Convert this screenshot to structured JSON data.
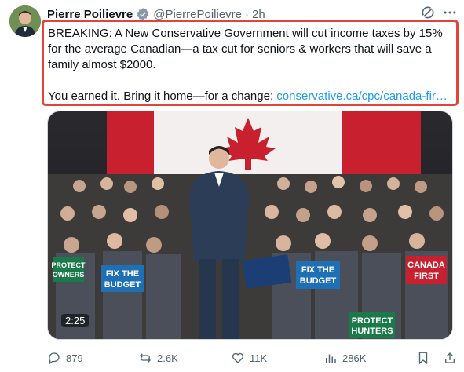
{
  "author": {
    "name": "Pierre Poilievre",
    "handle": "@PierrePoilievre",
    "separator": "·",
    "time": "2h"
  },
  "post": {
    "line1": "BREAKING: A New Conservative Government will cut income taxes by 15% for the average Canadian—a tax cut for seniors & workers that will save a family almost $2000.",
    "line2_text": "You earned it. Bring it home—for a change: ",
    "line2_link": "conservative.ca/cpc/canada-fir…"
  },
  "media": {
    "duration": "2:25",
    "signs": [
      "FIX THE BUDGET",
      "FIX THE BUDGET",
      "CANADA FIRST",
      "PROTECT HUNTERS",
      "PROTECT OWNERS"
    ]
  },
  "actions": {
    "replies": "879",
    "reposts": "2.6K",
    "likes": "11K",
    "views": "286K"
  },
  "colors": {
    "highlight_border": "#e0443b",
    "link": "#1d9bf0",
    "muted": "#536471",
    "verified": "#829aab"
  },
  "icons": [
    "verified-badge-icon",
    "grok-icon",
    "more-icon",
    "reply-icon",
    "repost-icon",
    "like-icon",
    "views-icon",
    "bookmark-icon",
    "share-icon"
  ]
}
